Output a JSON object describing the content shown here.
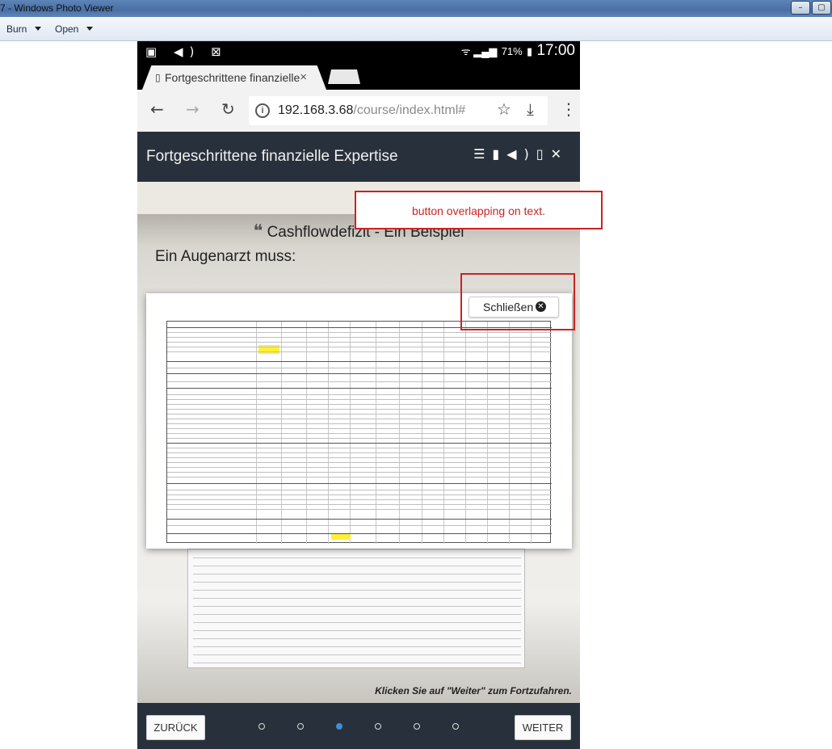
{
  "window": {
    "title": "7 - Windows Photo Viewer",
    "controls": [
      "–",
      "▢"
    ]
  },
  "menu": {
    "burn": "Burn",
    "open": "Open"
  },
  "statusbar": {
    "left_icons": "▣ ◀) ⊠",
    "battery": "71%",
    "time": "17:00"
  },
  "browser": {
    "tab_title": "Fortgeschrittene finanzielle",
    "tab_close": "×",
    "url_host": "192.168.3.68",
    "url_path": "/course/index.html#"
  },
  "app": {
    "title": "Fortgeschrittene finanzielle Expertise",
    "icons": [
      "list-icon",
      "bookmark-icon",
      "audio-icon",
      "document-icon",
      "close-icon"
    ]
  },
  "slide": {
    "title": "Cashflowdefizit - Ein Beispiel",
    "title_quote": "❝",
    "subtitle": "Ein Augenarzt muss:",
    "close_button": "Schließen",
    "hint": "Klicken Sie auf \"Weiter\" zum Fortzufahren."
  },
  "nav": {
    "back": "ZURÜCK",
    "next": "WEITER",
    "dots_total": 6,
    "dot_active": 3
  },
  "annotation": {
    "text": "button overlapping on text."
  }
}
